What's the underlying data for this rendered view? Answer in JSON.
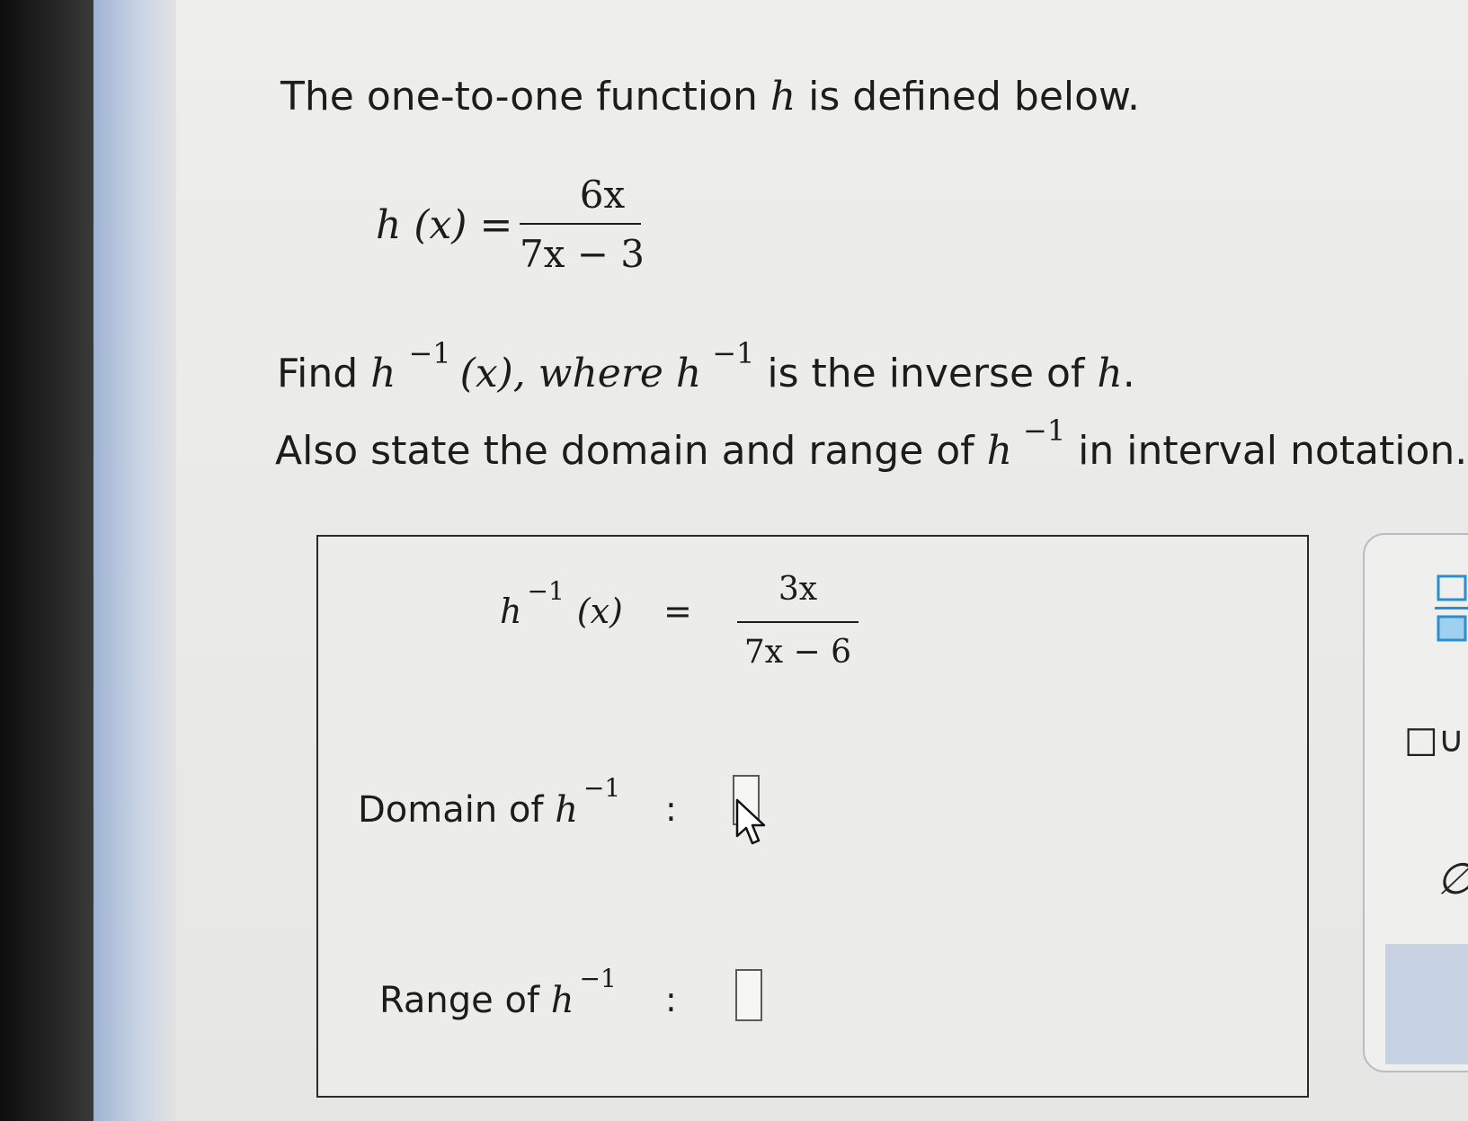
{
  "problem": {
    "line1_prefix": "The one-to-one function ",
    "func_name": "h",
    "line1_suffix": " is defined below.",
    "definition_lhs": "h (x) =",
    "definition_numerator": "6x",
    "definition_denominator": "7x − 3",
    "find_prefix": "Find ",
    "inverse_exponent": "−1",
    "find_arg": "(x), where ",
    "find_suffix": " is the inverse of ",
    "find_end": ".",
    "also_prefix": "Also state the domain and range of ",
    "also_suffix": " in interval notation."
  },
  "answer": {
    "inverse_lhs_func": "h",
    "inverse_lhs_exp": "−1",
    "inverse_lhs_arg": "(x)",
    "equals": "=",
    "numerator_value": "3x",
    "denominator_value": "7x − 6",
    "domain_label": "Domain of ",
    "domain_func": "h",
    "domain_exp": "−1",
    "domain_colon": ":",
    "domain_value": "",
    "range_label": "Range of ",
    "range_func": "h",
    "range_exp": "−1",
    "range_colon": ":",
    "range_value": ""
  },
  "toolbar": {
    "fraction_icon": "fraction-icon",
    "union_label": "□∪",
    "empty_set_label": "∅"
  },
  "colors": {
    "page_bg": "#ebebea",
    "text": "#1c1c1c",
    "toolbar_accent": "#2b8fcf"
  }
}
